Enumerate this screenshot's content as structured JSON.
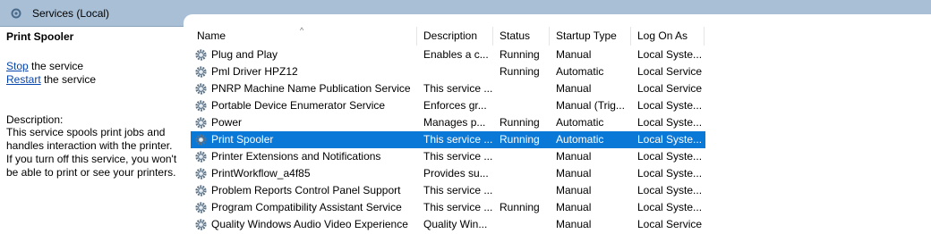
{
  "window": {
    "title": "Services (Local)"
  },
  "left_pane": {
    "service_name": "Print Spooler",
    "actions": [
      {
        "link": "Stop",
        "rest": " the service"
      },
      {
        "link": "Restart",
        "rest": " the service"
      }
    ],
    "description_label": "Description:",
    "description": "This service spools print jobs and handles interaction with the printer. If you turn off this service, you won't be able to print or see your printers."
  },
  "columns": {
    "name": "Name",
    "description": "Description",
    "status": "Status",
    "startup": "Startup Type",
    "logon": "Log On As",
    "sort_indicator": "^"
  },
  "services": [
    {
      "name": "Plug and Play",
      "description": "Enables a c...",
      "status": "Running",
      "startup": "Manual",
      "logon": "Local Syste..."
    },
    {
      "name": "Pml Driver HPZ12",
      "description": "",
      "status": "Running",
      "startup": "Automatic",
      "logon": "Local Service"
    },
    {
      "name": "PNRP Machine Name Publication Service",
      "description": "This service ...",
      "status": "",
      "startup": "Manual",
      "logon": "Local Service"
    },
    {
      "name": "Portable Device Enumerator Service",
      "description": "Enforces gr...",
      "status": "",
      "startup": "Manual (Trig...",
      "logon": "Local Syste..."
    },
    {
      "name": "Power",
      "description": "Manages p...",
      "status": "Running",
      "startup": "Automatic",
      "logon": "Local Syste..."
    },
    {
      "name": "Print Spooler",
      "description": "This service ...",
      "status": "Running",
      "startup": "Automatic",
      "logon": "Local Syste...",
      "selected": true
    },
    {
      "name": "Printer Extensions and Notifications",
      "description": "This service ...",
      "status": "",
      "startup": "Manual",
      "logon": "Local Syste..."
    },
    {
      "name": "PrintWorkflow_a4f85",
      "description": "Provides su...",
      "status": "",
      "startup": "Manual",
      "logon": "Local Syste..."
    },
    {
      "name": "Problem Reports Control Panel Support",
      "description": "This service ...",
      "status": "",
      "startup": "Manual",
      "logon": "Local Syste..."
    },
    {
      "name": "Program Compatibility Assistant Service",
      "description": "This service ...",
      "status": "Running",
      "startup": "Manual",
      "logon": "Local Syste..."
    },
    {
      "name": "Quality Windows Audio Video Experience",
      "description": "Quality Win...",
      "status": "",
      "startup": "Manual",
      "logon": "Local Service"
    }
  ],
  "colors": {
    "selection": "#0a78d7",
    "title_bar": "#a8bfd6",
    "link": "#0645ad"
  }
}
